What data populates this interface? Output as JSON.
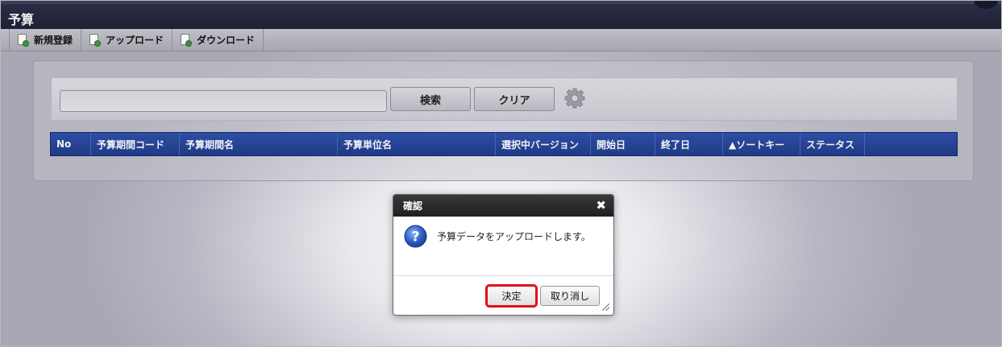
{
  "header": {
    "title": "予算"
  },
  "toolbar": {
    "items": [
      {
        "label": "新規登録",
        "icon": "new-document-icon"
      },
      {
        "label": "アップロード",
        "icon": "upload-document-icon"
      },
      {
        "label": "ダウンロード",
        "icon": "download-document-icon"
      }
    ]
  },
  "search": {
    "value": "",
    "placeholder": "",
    "search_label": "検索",
    "clear_label": "クリア",
    "settings_icon": "gear-icon"
  },
  "table": {
    "columns": [
      "No",
      "予算期間コード",
      "予算期間名",
      "予算単位名",
      "選択中バージョン",
      "開始日",
      "終了日",
      "▲ソートキー",
      "ステータス",
      ""
    ]
  },
  "dialog": {
    "title": "確認",
    "close_icon": "close-icon",
    "icon": "question-icon",
    "message": "予算データをアップロードします。",
    "ok_label": "決定",
    "cancel_label": "取り消し"
  },
  "colors": {
    "header_bg": "#1e2035",
    "table_header_bg": "#1f3a87",
    "highlight": "#e0101a"
  }
}
